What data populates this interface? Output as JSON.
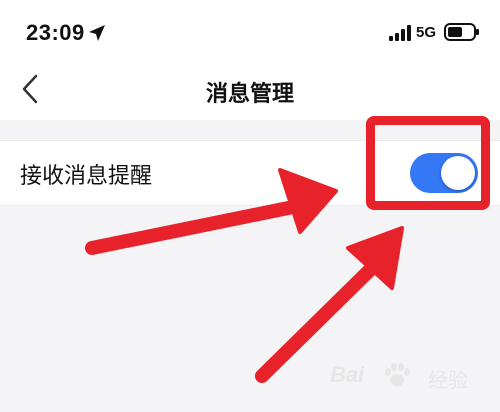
{
  "status_bar": {
    "time": "23:09",
    "network": "5G",
    "icons": [
      "location-arrow-icon",
      "signal-bars-icon",
      "battery-icon"
    ]
  },
  "nav": {
    "title": "消息管理",
    "back_icon": "chevron-left-icon"
  },
  "settings": {
    "rows": [
      {
        "label": "接收消息提醒",
        "toggle_on": true
      }
    ]
  },
  "annotation": {
    "highlight_color": "#e8222a"
  },
  "colors": {
    "toggle_on": "#3478f6",
    "background": "#f4f4f6"
  },
  "watermark": {
    "brand": "Bai",
    "brand_suffix": "经验"
  }
}
